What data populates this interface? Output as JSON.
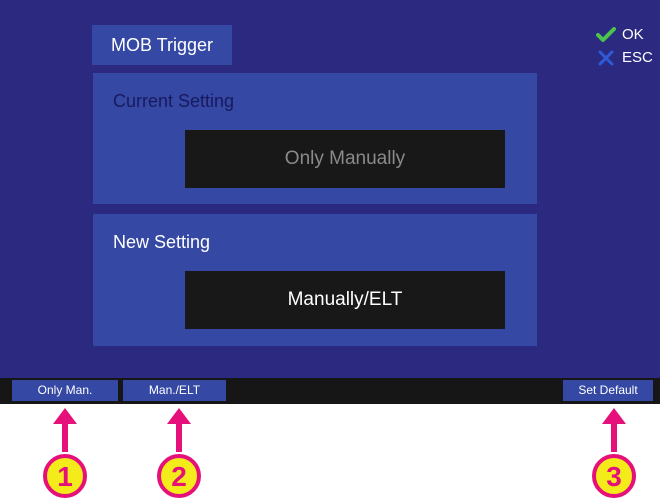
{
  "screen": {
    "title": "MOB Trigger",
    "ok_label": "OK",
    "esc_label": "ESC",
    "ok_icon": "check-icon",
    "esc_icon": "close-icon"
  },
  "current_setting": {
    "label": "Current Setting",
    "value": "Only Manually"
  },
  "new_setting": {
    "label": "New Setting",
    "value": "Manually/ELT"
  },
  "softkeys": [
    {
      "label": "Only Man."
    },
    {
      "label": "Man./ELT"
    },
    {
      "label": "Set Default"
    }
  ],
  "callouts": [
    "1",
    "2",
    "3"
  ],
  "colors": {
    "screen_bg": "#2b2a80",
    "panel_bg": "#3448a4",
    "value_bg": "#181818",
    "callout": "#e6107a",
    "callout_fill": "#f4ec1a",
    "ok_check": "#4cc44c",
    "esc_x": "#2f5bd8"
  }
}
